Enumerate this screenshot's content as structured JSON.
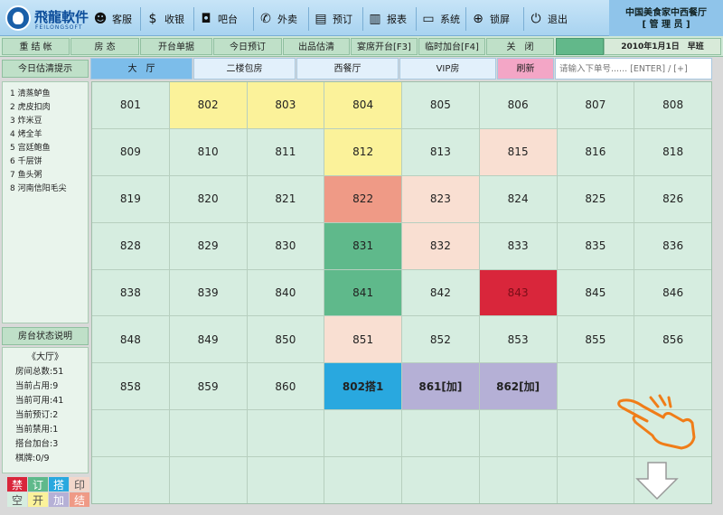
{
  "logo": {
    "title": "飛龍軟件",
    "subtitle": "FEILONGSOFT"
  },
  "toolbar": [
    {
      "label": "客服",
      "icon": "headset-icon",
      "glyph": "☻"
    },
    {
      "label": "收银",
      "icon": "dollar-icon",
      "glyph": "$"
    },
    {
      "label": "吧台",
      "icon": "cup-icon",
      "glyph": "◘"
    },
    {
      "label": "外卖",
      "icon": "phone-icon",
      "glyph": "✆"
    },
    {
      "label": "预订",
      "icon": "notebook-icon",
      "glyph": "▤"
    },
    {
      "label": "报表",
      "icon": "chart-icon",
      "glyph": "▥"
    },
    {
      "label": "系统",
      "icon": "monitor-icon",
      "glyph": "▭"
    },
    {
      "label": "锁屏",
      "icon": "lock-icon",
      "glyph": "⊕"
    },
    {
      "label": "退出",
      "icon": "power-icon",
      "glyph": "⏻"
    }
  ],
  "restaurant": {
    "name": "中国美食家中西餐厅",
    "role": "[ 管 理 员 ]"
  },
  "nav": [
    "重 结 帐",
    "房 态",
    "开台单据",
    "今日预订",
    "出品估清",
    "宴席开台[F3]",
    "临时加台[F4]",
    "关　闭"
  ],
  "date_label": "2010年1月1日　早班",
  "left_panel": {
    "estimate_title": "今日估清提示",
    "estimate_items": [
      "1 清蒸鲈鱼",
      "2 虎皮扣肉",
      "3 炸米豆",
      "4 烤全羊",
      "5 宫廷鲍鱼",
      "6 千层饼",
      "7 鱼头粥",
      "8 河南信阳毛尖"
    ],
    "status_title": "房台状态说明",
    "hall_name": "《大厅》",
    "stats": [
      "房间总数:51",
      "当前占用:9",
      "当前可用:41",
      "当前预订:2",
      "当前禁用:1",
      "搭台加台:3",
      "棋牌:0/9"
    ]
  },
  "legend": [
    {
      "label": "禁",
      "color": "#d9263b"
    },
    {
      "label": "订",
      "color": "#5fb98b"
    },
    {
      "label": "搭",
      "color": "#29a8df"
    },
    {
      "label": "印",
      "color": "#f2d7cb",
      "text_color": "#555"
    },
    {
      "label": "空",
      "color": "#d6ede0",
      "text_color": "#555"
    },
    {
      "label": "开",
      "color": "#fbf29a",
      "text_color": "#555"
    },
    {
      "label": "加",
      "color": "#b5b0d6"
    },
    {
      "label": "结",
      "color": "#ef9a86"
    }
  ],
  "tabs": [
    {
      "label": "大　厅",
      "active": true
    },
    {
      "label": "二楼包房",
      "active": false
    },
    {
      "label": "西餐厅",
      "active": false
    },
    {
      "label": "VIP房",
      "active": false
    },
    {
      "label": "刷新",
      "active": false
    }
  ],
  "order_input": {
    "placeholder": "请输入下单号...... [ENTER] / [+]"
  },
  "tables": [
    {
      "label": "801",
      "status": "empty"
    },
    {
      "label": "802",
      "status": "open"
    },
    {
      "label": "803",
      "status": "open"
    },
    {
      "label": "804",
      "status": "open"
    },
    {
      "label": "805",
      "status": "empty"
    },
    {
      "label": "806",
      "status": "empty"
    },
    {
      "label": "807",
      "status": "empty"
    },
    {
      "label": "808",
      "status": "empty"
    },
    {
      "label": "809",
      "status": "empty"
    },
    {
      "label": "810",
      "status": "empty"
    },
    {
      "label": "811",
      "status": "empty"
    },
    {
      "label": "812",
      "status": "open"
    },
    {
      "label": "813",
      "status": "empty"
    },
    {
      "label": "815",
      "status": "printed"
    },
    {
      "label": "816",
      "status": "empty"
    },
    {
      "label": "818",
      "status": "empty"
    },
    {
      "label": "819",
      "status": "empty"
    },
    {
      "label": "820",
      "status": "empty"
    },
    {
      "label": "821",
      "status": "empty"
    },
    {
      "label": "822",
      "status": "checkout"
    },
    {
      "label": "823",
      "status": "printed"
    },
    {
      "label": "824",
      "status": "empty"
    },
    {
      "label": "825",
      "status": "empty"
    },
    {
      "label": "826",
      "status": "empty"
    },
    {
      "label": "828",
      "status": "empty"
    },
    {
      "label": "829",
      "status": "empty"
    },
    {
      "label": "830",
      "status": "empty"
    },
    {
      "label": "831",
      "status": "reserved"
    },
    {
      "label": "832",
      "status": "printed"
    },
    {
      "label": "833",
      "status": "empty"
    },
    {
      "label": "835",
      "status": "empty"
    },
    {
      "label": "836",
      "status": "empty"
    },
    {
      "label": "838",
      "status": "empty"
    },
    {
      "label": "839",
      "status": "empty"
    },
    {
      "label": "840",
      "status": "empty"
    },
    {
      "label": "841",
      "status": "reserved"
    },
    {
      "label": "842",
      "status": "empty"
    },
    {
      "label": "843",
      "status": "disabled"
    },
    {
      "label": "845",
      "status": "empty"
    },
    {
      "label": "846",
      "status": "empty"
    },
    {
      "label": "848",
      "status": "empty"
    },
    {
      "label": "849",
      "status": "empty"
    },
    {
      "label": "850",
      "status": "empty"
    },
    {
      "label": "851",
      "status": "printed"
    },
    {
      "label": "852",
      "status": "empty"
    },
    {
      "label": "853",
      "status": "empty"
    },
    {
      "label": "855",
      "status": "empty"
    },
    {
      "label": "856",
      "status": "empty"
    },
    {
      "label": "858",
      "status": "empty"
    },
    {
      "label": "859",
      "status": "empty"
    },
    {
      "label": "860",
      "status": "empty"
    },
    {
      "label": "802搭1",
      "status": "shared"
    },
    {
      "label": "861[加]",
      "status": "added"
    },
    {
      "label": "862[加]",
      "status": "added"
    },
    {
      "label": "",
      "status": "empty"
    },
    {
      "label": "",
      "status": "empty"
    },
    {
      "label": "",
      "status": "empty"
    },
    {
      "label": "",
      "status": "empty"
    },
    {
      "label": "",
      "status": "empty"
    },
    {
      "label": "",
      "status": "empty"
    },
    {
      "label": "",
      "status": "empty"
    },
    {
      "label": "",
      "status": "empty"
    },
    {
      "label": "",
      "status": "empty"
    },
    {
      "label": "",
      "status": "empty"
    },
    {
      "label": "",
      "status": "empty"
    },
    {
      "label": "",
      "status": "empty"
    },
    {
      "label": "",
      "status": "empty"
    },
    {
      "label": "",
      "status": "empty"
    },
    {
      "label": "",
      "status": "empty"
    },
    {
      "label": "",
      "status": "empty"
    },
    {
      "label": "",
      "status": "empty"
    },
    {
      "label": "",
      "status": "empty"
    }
  ],
  "status_colors": {
    "empty": "#d6ede0",
    "open": "#fbf29a",
    "printed": "#f9dfd2",
    "checkout": "#ef9a86",
    "reserved": "#5fb98b",
    "disabled": "#d9263b",
    "shared": "#29a8df",
    "added": "#b5b0d6"
  }
}
